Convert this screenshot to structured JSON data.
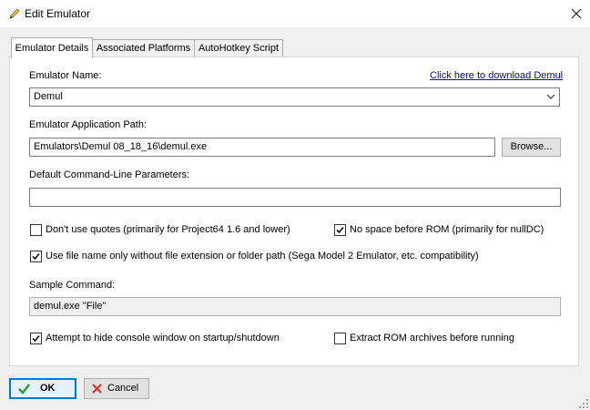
{
  "window": {
    "title": "Edit Emulator",
    "close_glyph": "✕"
  },
  "tabs": [
    {
      "label": "Emulator Details",
      "active": true
    },
    {
      "label": "Associated Platforms",
      "active": false
    },
    {
      "label": "AutoHotkey Script",
      "active": false
    }
  ],
  "details": {
    "emulator_name_label": "Emulator Name:",
    "download_link": "Click here to download Demul",
    "emulator_name_value": "Demul",
    "app_path_label": "Emulator Application Path:",
    "app_path_value": "Emulators\\Demul 08_18_16\\demul.exe",
    "browse_label": "Browse...",
    "params_label": "Default Command-Line Parameters:",
    "params_value": "",
    "chk_no_quotes": {
      "label": "Don't use quotes (primarily for Project64 1.6 and lower)",
      "checked": false
    },
    "chk_no_space": {
      "label": "No space before ROM (primarily for nullDC)",
      "checked": true
    },
    "chk_filename_only": {
      "label": "Use file name only without file extension or folder path (Sega Model 2 Emulator, etc. compatibility)",
      "checked": true
    },
    "sample_label": "Sample Command:",
    "sample_value": "demul.exe \"File\"",
    "chk_hide_console": {
      "label": "Attempt to hide console window on startup/shutdown",
      "checked": true
    },
    "chk_extract": {
      "label": "Extract ROM archives before running",
      "checked": false
    }
  },
  "buttons": {
    "ok": "OK",
    "cancel": "Cancel"
  },
  "colors": {
    "ok_check": "#2e9e2e",
    "cancel_x": "#d83030",
    "link": "#0000cc",
    "title_icon": "#c0a040"
  },
  "icons": {
    "title": "pencil-icon",
    "ok": "checkmark-icon",
    "cancel": "cancel-x-icon"
  }
}
